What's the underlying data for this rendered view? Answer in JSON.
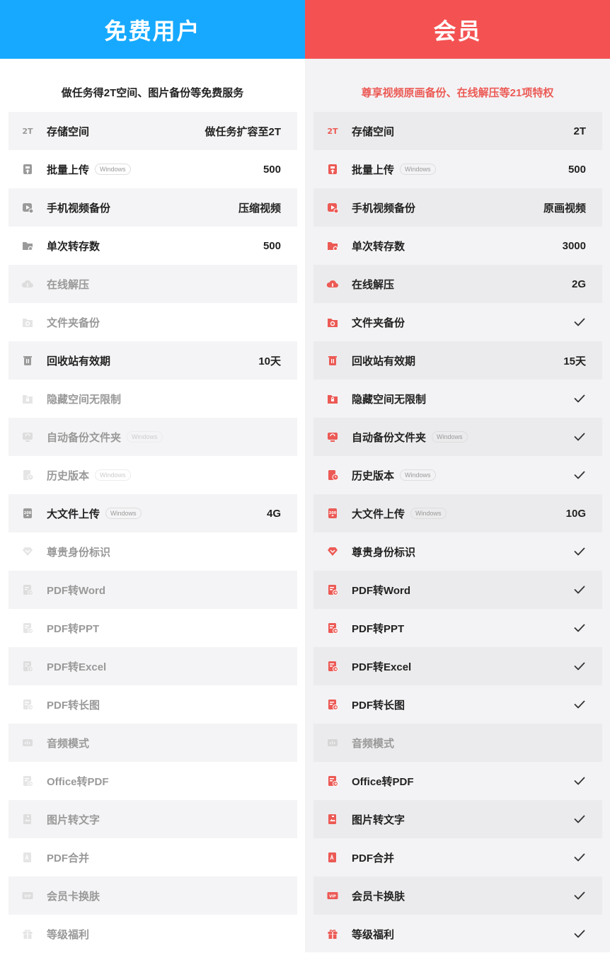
{
  "colors": {
    "free_header": "#17a9ff",
    "vip_header": "#f45252",
    "vip_accent": "#ec5a55",
    "gray_icon": "#9a9a9a"
  },
  "free": {
    "title": "免费用户",
    "subtitle": "做任务得2T空间、图片备份等免费服务",
    "rows": [
      {
        "icon": "storage-2t-icon",
        "label": "存储空间",
        "value": "做任务扩容至2T",
        "disabled": false
      },
      {
        "icon": "batch-upload-icon",
        "label": "批量上传",
        "tag": "Windows",
        "value": "500",
        "disabled": false
      },
      {
        "icon": "video-backup-icon",
        "label": "手机视频备份",
        "value": "压缩视频",
        "disabled": false
      },
      {
        "icon": "folder-transfer-icon",
        "label": "单次转存数",
        "value": "500",
        "disabled": false
      },
      {
        "icon": "cloud-unzip-icon",
        "label": "在线解压",
        "disabled": true
      },
      {
        "icon": "folder-backup-icon",
        "label": "文件夹备份",
        "disabled": true
      },
      {
        "icon": "trash-icon",
        "label": "回收站有效期",
        "value": "10天",
        "disabled": false
      },
      {
        "icon": "hidden-space-icon",
        "label": "隐藏空间无限制",
        "disabled": true
      },
      {
        "icon": "auto-backup-icon",
        "label": "自动备份文件夹",
        "tag": "Windows",
        "disabled": true
      },
      {
        "icon": "history-version-icon",
        "label": "历史版本",
        "tag": "Windows",
        "disabled": true
      },
      {
        "icon": "large-file-icon",
        "label": "大文件上传",
        "tag": "Windows",
        "value": "4G",
        "disabled": false
      },
      {
        "icon": "vip-badge-icon",
        "label": "尊贵身份标识",
        "disabled": true
      },
      {
        "icon": "pdf-word-icon",
        "label": "PDF转Word",
        "disabled": true
      },
      {
        "icon": "pdf-ppt-icon",
        "label": "PDF转PPT",
        "disabled": true
      },
      {
        "icon": "pdf-excel-icon",
        "label": "PDF转Excel",
        "disabled": true
      },
      {
        "icon": "pdf-longimage-icon",
        "label": "PDF转长图",
        "disabled": true
      },
      {
        "icon": "audio-mode-icon",
        "label": "音频模式",
        "disabled": true
      },
      {
        "icon": "office-pdf-icon",
        "label": "Office转PDF",
        "disabled": true
      },
      {
        "icon": "image-text-icon",
        "label": "图片转文字",
        "disabled": true
      },
      {
        "icon": "pdf-merge-icon",
        "label": "PDF合并",
        "disabled": true
      },
      {
        "icon": "vip-card-skin-icon",
        "label": "会员卡换肤",
        "disabled": true
      },
      {
        "icon": "gift-icon",
        "label": "等级福利",
        "disabled": true
      }
    ]
  },
  "vip": {
    "title": "会员",
    "subtitle": "尊享视频原画备份、在线解压等21项特权",
    "rows": [
      {
        "icon": "storage-2t-icon",
        "label": "存储空间",
        "value": "2T",
        "disabled": false
      },
      {
        "icon": "batch-upload-icon",
        "label": "批量上传",
        "tag": "Windows",
        "value": "500",
        "disabled": false
      },
      {
        "icon": "video-backup-icon",
        "label": "手机视频备份",
        "value": "原画视频",
        "disabled": false
      },
      {
        "icon": "folder-transfer-icon",
        "label": "单次转存数",
        "value": "3000",
        "disabled": false
      },
      {
        "icon": "cloud-unzip-icon",
        "label": "在线解压",
        "value": "2G",
        "disabled": false
      },
      {
        "icon": "folder-backup-icon",
        "label": "文件夹备份",
        "check": true,
        "disabled": false
      },
      {
        "icon": "trash-icon",
        "label": "回收站有效期",
        "value": "15天",
        "disabled": false
      },
      {
        "icon": "hidden-space-icon",
        "label": "隐藏空间无限制",
        "check": true,
        "disabled": false
      },
      {
        "icon": "auto-backup-icon",
        "label": "自动备份文件夹",
        "tag": "Windows",
        "check": true,
        "disabled": false
      },
      {
        "icon": "history-version-icon",
        "label": "历史版本",
        "tag": "Windows",
        "check": true,
        "disabled": false
      },
      {
        "icon": "large-file-icon",
        "label": "大文件上传",
        "tag": "Windows",
        "value": "10G",
        "disabled": false
      },
      {
        "icon": "vip-badge-icon",
        "label": "尊贵身份标识",
        "check": true,
        "disabled": false
      },
      {
        "icon": "pdf-word-icon",
        "label": "PDF转Word",
        "check": true,
        "disabled": false
      },
      {
        "icon": "pdf-ppt-icon",
        "label": "PDF转PPT",
        "check": true,
        "disabled": false
      },
      {
        "icon": "pdf-excel-icon",
        "label": "PDF转Excel",
        "check": true,
        "disabled": false
      },
      {
        "icon": "pdf-longimage-icon",
        "label": "PDF转长图",
        "check": true,
        "disabled": false
      },
      {
        "icon": "audio-mode-icon",
        "label": "音频模式",
        "disabled": true
      },
      {
        "icon": "office-pdf-icon",
        "label": "Office转PDF",
        "check": true,
        "disabled": false
      },
      {
        "icon": "image-text-icon",
        "label": "图片转文字",
        "check": true,
        "disabled": false
      },
      {
        "icon": "pdf-merge-icon",
        "label": "PDF合并",
        "check": true,
        "disabled": false
      },
      {
        "icon": "vip-card-skin-icon",
        "label": "会员卡换肤",
        "check": true,
        "disabled": false
      },
      {
        "icon": "gift-icon",
        "label": "等级福利",
        "check": true,
        "disabled": false
      }
    ]
  }
}
